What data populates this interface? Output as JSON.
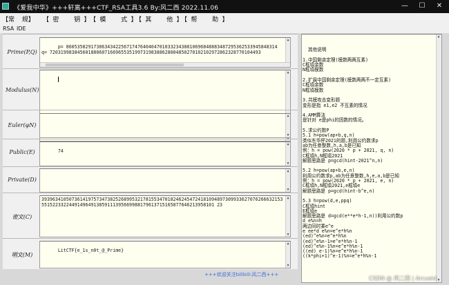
{
  "window": {
    "title": "《爱我中华》+++轩离+++CTF_RSA工具3.6  By:风二西 2022.11.06",
    "controls": {
      "minimize": "—",
      "maximize": "☐",
      "close": "✕"
    }
  },
  "menu": {
    "items": [
      {
        "label": "【常  规】"
      },
      {
        "label": "【 密    钥 】"
      },
      {
        "label": "【 模    式 】"
      },
      {
        "label": "【 其    他 】"
      },
      {
        "label": "【 帮    助 】"
      }
    ]
  },
  "tabs": [
    {
      "label": "RSA"
    },
    {
      "label": "IDE"
    }
  ],
  "fields": {
    "pq": {
      "label": "Prime(P,Q)",
      "value": "p= 86053582917386343422567174764040470103323438810696848883487295362533945848314\nq= 72031998384560188060716696553519973198388628004850270102102972862328770104493"
    },
    "modulus": {
      "label": "Modulus(N)",
      "value": ""
    },
    "euler": {
      "label": "Euler(φN)",
      "value": ""
    },
    "public": {
      "label": "Public(E)",
      "value": "74"
    },
    "private": {
      "label": "Private(D)",
      "value": ""
    },
    "ciphertext": {
      "label": "密文(C)",
      "value": "3939634105073614197573473825268995321781553470182462454724181094897309933627076266632153551522332244914964913859111395669988179613715165877646213958101 23"
    },
    "plaintext": {
      "label": "明文(M)",
      "value": "LitCTF{e_1s_n0t_@_Prime}"
    }
  },
  "footer": {
    "link_text": "+++欢迎关注bilibili:风二西+++"
  },
  "help": {
    "content": "其他说明\n\n1.中国剩余定理(模数两两互素)\nC框填余数\nN框填模数\n\n2.扩展中国剩余定理(模数两两不一定互素)\nC框填余数\nN框填模数\n\n3.共模攻击变形题\n变形是指 e1,e2 不互素的情况\n\n4.AMM算法\n是针对 e是phi的因数的情况。\n\n5.求公约数P\n5.1 h=pow(ap+b,q,n)\n类似东华杯2021的题,利用公约数求p\nab为任意整数,h,a,b是已知\n例：h = pow(2020 * p + 2021, q, n)\nC框填h,N框填2021\n解题思路是 p=gcd(hint-2021^n,n)\n\n5.2 h=pow(ap+b,e,n)\n利用公约数求p,ab为任意整数,h,e,a,b是已知\n例：h = pow(2020 * p + 2021, e, n)\nC框填h,N框填2021,e框填e\n解题思路是 p=gcd(hint-b^e,n)\n\n5.3 h=pow(d,e,ppq)\nC框填hint\nE框填e\n解题思路是 d=gcd(e**e*h-1,n))利用公约数p\nd e%n=h\n两边同时乘e^e\ne ee*d e%n=e^e*h%n\n(ed)^e%n=e^e*h%n\n(ed)^e%n-1=e^e*h%n-1\n(ed)^e%n-1%n=e^e*h%n-1\n((ed) e-1)%n=e^e*h%n-1\n((k*phi+1)^e-1)%n=e^e*h%n-1"
  },
  "watermark": {
    "text": "CSDN @ 风二西 | Arcueid"
  }
}
